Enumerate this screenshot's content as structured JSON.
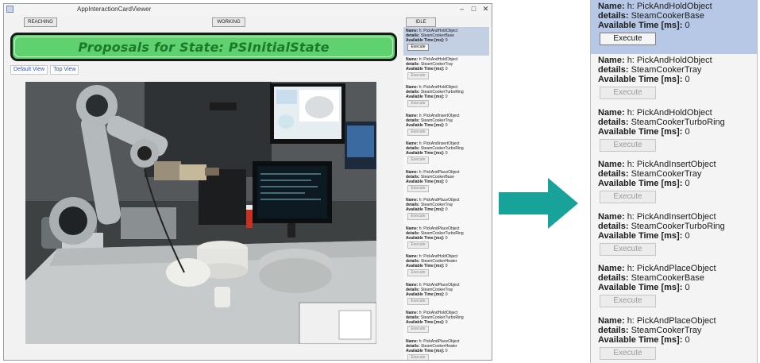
{
  "window": {
    "title": "AppInteractionCardViewer",
    "controls": {
      "minimize": "–",
      "maximize": "□",
      "close": "✕"
    },
    "state_buttons": {
      "reaching": "REACHING",
      "working": "WORKING",
      "idle": "IDLE"
    },
    "banner": "Proposals for State: PSInitialState",
    "views": {
      "default": "Default View",
      "top": "Top View"
    }
  },
  "labels": {
    "name": "Name:",
    "details": "details:",
    "available_time": "Available Time [ms]:",
    "execute": "Execute"
  },
  "cards_small": [
    {
      "action": "h: PickAndHoldObject",
      "details": "SteamCookerBase",
      "time": "0",
      "selected": true
    },
    {
      "action": "h: PickAndHoldObject",
      "details": "SteamCookerTray",
      "time": "0",
      "selected": false
    },
    {
      "action": "h: PickAndHoldObject",
      "details": "SteamCookerTurboRing",
      "time": "0",
      "selected": false
    },
    {
      "action": "h: PickAndInsertObject",
      "details": "SteamCookerTray",
      "time": "0",
      "selected": false
    },
    {
      "action": "h: PickAndInsertObject",
      "details": "SteamCookerTurboRing",
      "time": "0",
      "selected": false
    },
    {
      "action": "h: PickAndPlaceObject",
      "details": "SteamCookerBase",
      "time": "0",
      "selected": false
    },
    {
      "action": "h: PickAndPlaceObject",
      "details": "SteamCookerTray",
      "time": "0",
      "selected": false
    },
    {
      "action": "h: PickAndPlaceObject",
      "details": "SteamCookerTurboRing",
      "time": "0",
      "selected": false
    },
    {
      "action": "h: PickAndHoldObject",
      "details": "SteamCookerHeater",
      "time": "0",
      "selected": false
    },
    {
      "action": "h: PickAndPlaceObject",
      "details": "SteamCookerTray",
      "time": "0",
      "selected": false
    },
    {
      "action": "h: PickAndHoldObject",
      "details": "SteamCookerTurboRing",
      "time": "0",
      "selected": false
    },
    {
      "action": "h: PickAndPlaceObject",
      "details": "SteamCookerHeater",
      "time": "0",
      "selected": false
    }
  ],
  "cards_zoom": [
    {
      "action": "h: PickAndHoldObject",
      "details": "SteamCookerBase",
      "time": "0",
      "selected": true
    },
    {
      "action": "h: PickAndHoldObject",
      "details": "SteamCookerTray",
      "time": "0",
      "selected": false
    },
    {
      "action": "h: PickAndHoldObject",
      "details": "SteamCookerTurboRing",
      "time": "0",
      "selected": false
    },
    {
      "action": "h: PickAndInsertObject",
      "details": "SteamCookerTray",
      "time": "0",
      "selected": false
    },
    {
      "action": "h: PickAndInsertObject",
      "details": "SteamCookerTurboRing",
      "time": "0",
      "selected": false
    },
    {
      "action": "h: PickAndPlaceObject",
      "details": "SteamCookerBase",
      "time": "0",
      "selected": false
    },
    {
      "action": "h: PickAndPlaceObject",
      "details": "SteamCookerTray",
      "time": "0",
      "selected": false
    }
  ],
  "colors": {
    "banner_fill": "#5fd26f",
    "banner_text": "#1b7a2a",
    "selected_card": "#b7c8e6",
    "arrow": "#17a39a"
  },
  "icons": {
    "arrow": "right-arrow-icon",
    "app": "app-icon"
  }
}
